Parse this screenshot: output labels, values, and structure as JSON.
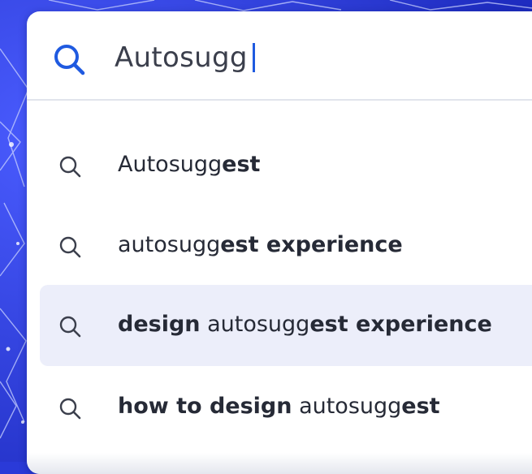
{
  "search": {
    "query": "Autosugg"
  },
  "suggestions": [
    {
      "parts": [
        {
          "t": "Autosugg",
          "w": "n"
        },
        {
          "t": "est",
          "w": "b"
        }
      ]
    },
    {
      "parts": [
        {
          "t": "autosugg",
          "w": "n"
        },
        {
          "t": "est experience",
          "w": "b"
        }
      ]
    },
    {
      "parts": [
        {
          "t": "design",
          "w": "b"
        },
        {
          "t": " autosugg",
          "w": "n"
        },
        {
          "t": "est experience",
          "w": "b"
        }
      ]
    },
    {
      "parts": [
        {
          "t": "how to design",
          "w": "b"
        },
        {
          "t": " autosugg",
          "w": "n"
        },
        {
          "t": "est",
          "w": "b"
        }
      ]
    }
  ],
  "active_index": 2,
  "colors": {
    "accent": "#1f5ae0",
    "background": "#2a3ad8",
    "highlight": "#eceefa",
    "text": "#262a36"
  },
  "icons": {
    "search_bar": "search-icon",
    "suggestion": "search-icon"
  }
}
